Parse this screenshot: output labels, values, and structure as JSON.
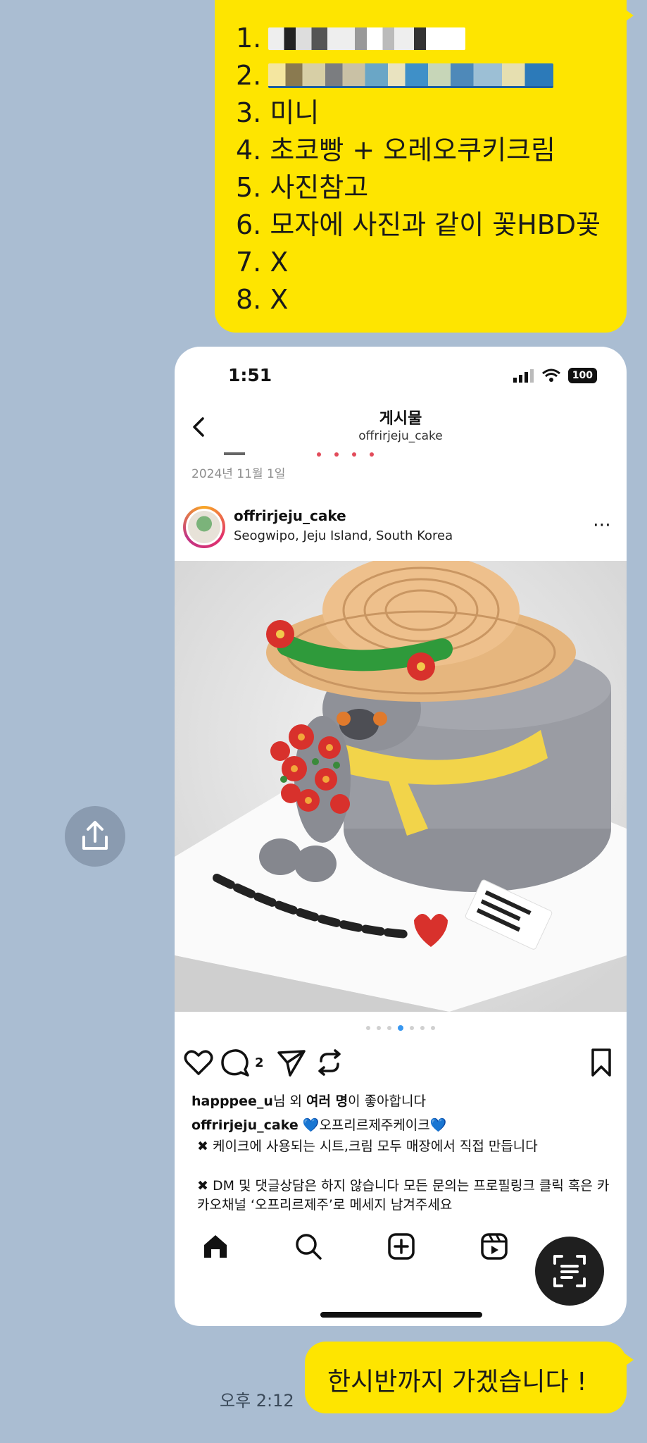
{
  "chat": {
    "top_bubble_items": [
      {
        "num": "1.",
        "text": ""
      },
      {
        "num": "2.",
        "text": ""
      },
      {
        "num": "3.",
        "text": "미니"
      },
      {
        "num": "4.",
        "text": "초코빵 + 오레오쿠키크림"
      },
      {
        "num": "5.",
        "text": "사진참고"
      },
      {
        "num": "6.",
        "text": "모자에 사진과 같이 꽃HBD꽃"
      },
      {
        "num": "7.",
        "text": "X"
      },
      {
        "num": "8.",
        "text": "X"
      }
    ],
    "bottom_bubble_text": "한시반까지 가겠습니다 !",
    "bottom_bubble_time": "오후 2:12",
    "bubble_color": "#fee500",
    "background_color": "#aabdd2"
  },
  "screenshot": {
    "status_time": "1:51",
    "battery": "100",
    "nav_title": "게시물",
    "nav_subtitle": "offrirjeju_cake",
    "date": "2024년 11월 1일",
    "post_user": "offrirjeju_cake",
    "post_location": "Seogwipo, Jeju Island, South Korea",
    "more_icon": "⋯",
    "comment_count": "2",
    "likes_user": "happpee_u",
    "likes_mid": "님 외 ",
    "likes_bold": "여러 명",
    "likes_end": "이 좋아합니다",
    "caption_user": "offrirjeju_cake",
    "caption_title": "💙오프리르제주케이크💙",
    "caption_line1": "✖ 케이크에 사용되는 시트,크림 모두 매장에서 직접 만듭니다",
    "caption_line2": "✖ DM 및 댓글상담은 하지 않습니다 모든 문의는 프로필링크 클릭 혹은 카카오채널 ‘오프리르제주’로 메세지 남겨주세요",
    "carousel_pages": 7,
    "carousel_active": 4
  },
  "icons": {
    "share": "share-icon",
    "scan": "text-scan-icon"
  }
}
